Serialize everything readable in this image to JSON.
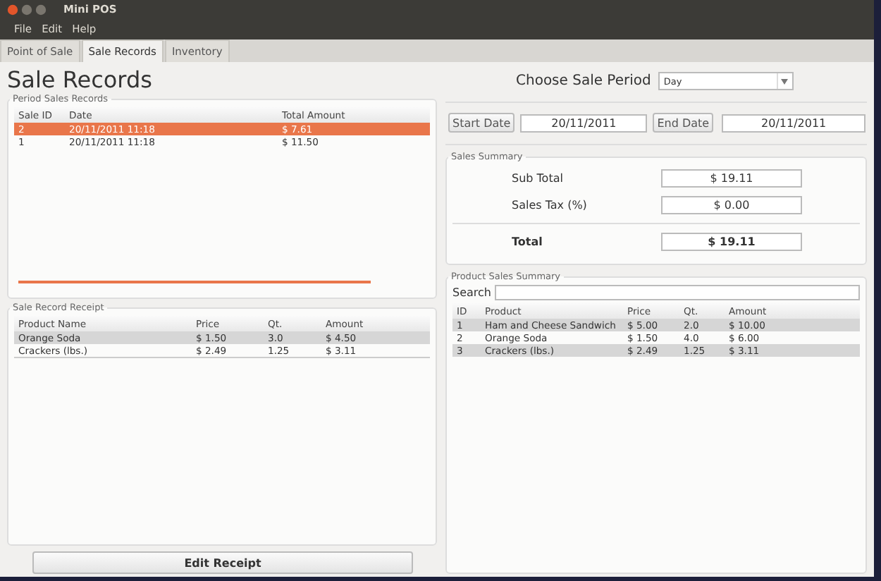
{
  "window": {
    "title": "Mini POS"
  },
  "menu": [
    "File",
    "Edit",
    "Help"
  ],
  "tabs": [
    {
      "label": "Point of Sale",
      "selected": false
    },
    {
      "label": "Sale Records",
      "selected": true
    },
    {
      "label": "Inventory",
      "selected": false
    }
  ],
  "heading": "Sale Records",
  "period_sales_records": {
    "title": "Period Sales Records",
    "columns": [
      "Sale ID",
      "Date",
      "Total Amount"
    ],
    "rows": [
      {
        "cells": [
          "2",
          "20/11/2011 11:18",
          "$ 7.61"
        ],
        "selected": true
      },
      {
        "cells": [
          "1",
          "20/11/2011 11:18",
          "$ 11.50"
        ],
        "selected": false
      }
    ]
  },
  "sale_record_receipt": {
    "title": "Sale Record Receipt",
    "columns": [
      "Product Name",
      "Price",
      "Qt.",
      "Amount"
    ],
    "rows": [
      [
        "Orange Soda",
        "$ 1.50",
        "3.0",
        "$ 4.50"
      ],
      [
        "Crackers (lbs.)",
        "$ 2.49",
        "1.25",
        "$ 3.11"
      ]
    ]
  },
  "edit_button": "Edit Receipt",
  "period": {
    "label": "Choose Sale Period",
    "value": "Day"
  },
  "start_date": {
    "button": "Start Date",
    "value": "20/11/2011"
  },
  "end_date": {
    "button": "End Date",
    "value": "20/11/2011"
  },
  "sales_summary": {
    "title": "Sales Summary",
    "lines": [
      {
        "label": "Sub Total",
        "value": "$ 19.11",
        "bold": false
      },
      {
        "label": "Sales Tax (%)",
        "value": "$ 0.00",
        "bold": false
      },
      {
        "label": "Total",
        "value": "$ 19.11",
        "bold": true
      }
    ]
  },
  "product_sales_summary": {
    "title": "Product Sales Summary",
    "search_label": "Search",
    "columns": [
      "ID",
      "Product",
      "Price",
      "Qt.",
      "Amount"
    ],
    "rows": [
      [
        "1",
        "Ham and Cheese Sandwich",
        "$ 5.00",
        "2.0",
        "$ 10.00"
      ],
      [
        "2",
        "Orange Soda",
        "$ 1.50",
        "4.0",
        "$ 6.00"
      ],
      [
        "3",
        "Crackers (lbs.)",
        "$ 2.49",
        "1.25",
        "$ 3.11"
      ]
    ]
  }
}
